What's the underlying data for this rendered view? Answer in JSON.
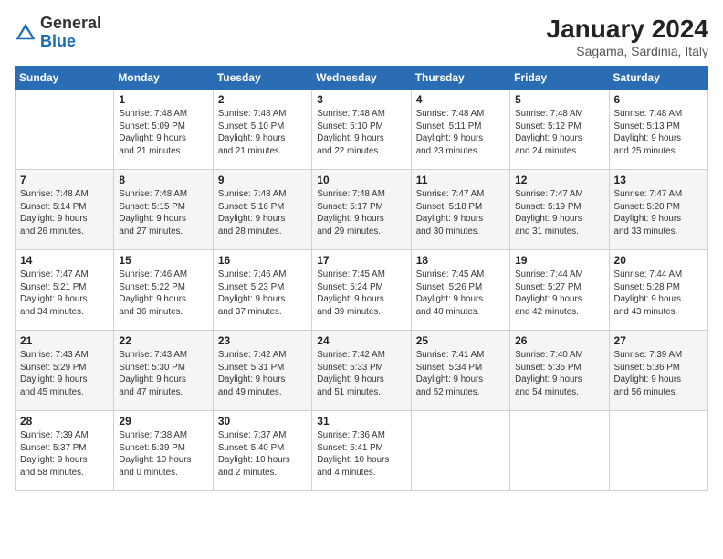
{
  "header": {
    "logo": {
      "general": "General",
      "blue": "Blue"
    },
    "title": "January 2024",
    "location": "Sagama, Sardinia, Italy"
  },
  "days_of_week": [
    "Sunday",
    "Monday",
    "Tuesday",
    "Wednesday",
    "Thursday",
    "Friday",
    "Saturday"
  ],
  "weeks": [
    [
      {
        "day": "",
        "info": ""
      },
      {
        "day": "1",
        "info": "Sunrise: 7:48 AM\nSunset: 5:09 PM\nDaylight: 9 hours\nand 21 minutes."
      },
      {
        "day": "2",
        "info": "Sunrise: 7:48 AM\nSunset: 5:10 PM\nDaylight: 9 hours\nand 21 minutes."
      },
      {
        "day": "3",
        "info": "Sunrise: 7:48 AM\nSunset: 5:10 PM\nDaylight: 9 hours\nand 22 minutes."
      },
      {
        "day": "4",
        "info": "Sunrise: 7:48 AM\nSunset: 5:11 PM\nDaylight: 9 hours\nand 23 minutes."
      },
      {
        "day": "5",
        "info": "Sunrise: 7:48 AM\nSunset: 5:12 PM\nDaylight: 9 hours\nand 24 minutes."
      },
      {
        "day": "6",
        "info": "Sunrise: 7:48 AM\nSunset: 5:13 PM\nDaylight: 9 hours\nand 25 minutes."
      }
    ],
    [
      {
        "day": "7",
        "info": "Sunrise: 7:48 AM\nSunset: 5:14 PM\nDaylight: 9 hours\nand 26 minutes."
      },
      {
        "day": "8",
        "info": "Sunrise: 7:48 AM\nSunset: 5:15 PM\nDaylight: 9 hours\nand 27 minutes."
      },
      {
        "day": "9",
        "info": "Sunrise: 7:48 AM\nSunset: 5:16 PM\nDaylight: 9 hours\nand 28 minutes."
      },
      {
        "day": "10",
        "info": "Sunrise: 7:48 AM\nSunset: 5:17 PM\nDaylight: 9 hours\nand 29 minutes."
      },
      {
        "day": "11",
        "info": "Sunrise: 7:47 AM\nSunset: 5:18 PM\nDaylight: 9 hours\nand 30 minutes."
      },
      {
        "day": "12",
        "info": "Sunrise: 7:47 AM\nSunset: 5:19 PM\nDaylight: 9 hours\nand 31 minutes."
      },
      {
        "day": "13",
        "info": "Sunrise: 7:47 AM\nSunset: 5:20 PM\nDaylight: 9 hours\nand 33 minutes."
      }
    ],
    [
      {
        "day": "14",
        "info": "Sunrise: 7:47 AM\nSunset: 5:21 PM\nDaylight: 9 hours\nand 34 minutes."
      },
      {
        "day": "15",
        "info": "Sunrise: 7:46 AM\nSunset: 5:22 PM\nDaylight: 9 hours\nand 36 minutes."
      },
      {
        "day": "16",
        "info": "Sunrise: 7:46 AM\nSunset: 5:23 PM\nDaylight: 9 hours\nand 37 minutes."
      },
      {
        "day": "17",
        "info": "Sunrise: 7:45 AM\nSunset: 5:24 PM\nDaylight: 9 hours\nand 39 minutes."
      },
      {
        "day": "18",
        "info": "Sunrise: 7:45 AM\nSunset: 5:26 PM\nDaylight: 9 hours\nand 40 minutes."
      },
      {
        "day": "19",
        "info": "Sunrise: 7:44 AM\nSunset: 5:27 PM\nDaylight: 9 hours\nand 42 minutes."
      },
      {
        "day": "20",
        "info": "Sunrise: 7:44 AM\nSunset: 5:28 PM\nDaylight: 9 hours\nand 43 minutes."
      }
    ],
    [
      {
        "day": "21",
        "info": "Sunrise: 7:43 AM\nSunset: 5:29 PM\nDaylight: 9 hours\nand 45 minutes."
      },
      {
        "day": "22",
        "info": "Sunrise: 7:43 AM\nSunset: 5:30 PM\nDaylight: 9 hours\nand 47 minutes."
      },
      {
        "day": "23",
        "info": "Sunrise: 7:42 AM\nSunset: 5:31 PM\nDaylight: 9 hours\nand 49 minutes."
      },
      {
        "day": "24",
        "info": "Sunrise: 7:42 AM\nSunset: 5:33 PM\nDaylight: 9 hours\nand 51 minutes."
      },
      {
        "day": "25",
        "info": "Sunrise: 7:41 AM\nSunset: 5:34 PM\nDaylight: 9 hours\nand 52 minutes."
      },
      {
        "day": "26",
        "info": "Sunrise: 7:40 AM\nSunset: 5:35 PM\nDaylight: 9 hours\nand 54 minutes."
      },
      {
        "day": "27",
        "info": "Sunrise: 7:39 AM\nSunset: 5:36 PM\nDaylight: 9 hours\nand 56 minutes."
      }
    ],
    [
      {
        "day": "28",
        "info": "Sunrise: 7:39 AM\nSunset: 5:37 PM\nDaylight: 9 hours\nand 58 minutes."
      },
      {
        "day": "29",
        "info": "Sunrise: 7:38 AM\nSunset: 5:39 PM\nDaylight: 10 hours\nand 0 minutes."
      },
      {
        "day": "30",
        "info": "Sunrise: 7:37 AM\nSunset: 5:40 PM\nDaylight: 10 hours\nand 2 minutes."
      },
      {
        "day": "31",
        "info": "Sunrise: 7:36 AM\nSunset: 5:41 PM\nDaylight: 10 hours\nand 4 minutes."
      },
      {
        "day": "",
        "info": ""
      },
      {
        "day": "",
        "info": ""
      },
      {
        "day": "",
        "info": ""
      }
    ]
  ]
}
